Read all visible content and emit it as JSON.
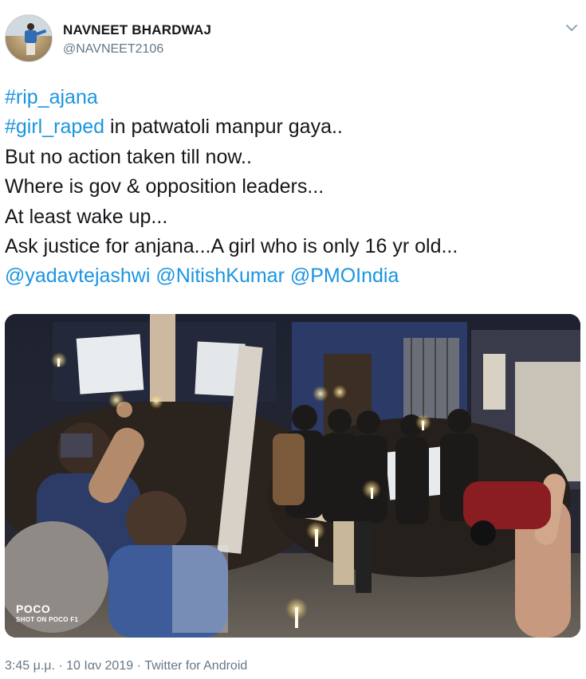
{
  "tweet": {
    "author_name": "NAVNEET BHARDWAJ",
    "author_handle": "@NAVNEET2106",
    "lines": [
      {
        "link": "#rip_ajana",
        "text": ""
      },
      {
        "link": "#girl_raped",
        "text": " in patwatoli manpur gaya.."
      },
      {
        "link": "",
        "text": "But no action taken till now.."
      },
      {
        "link": "",
        "text": "Where is gov & opposition leaders..."
      },
      {
        "link": "",
        "text": "At least wake up..."
      },
      {
        "link": "",
        "text": "Ask justice for anjana...A girl who is only 16 yr old..."
      }
    ],
    "mentions": [
      "@yadavtejashwi",
      "@NitishKumar",
      "@PMOIndia"
    ],
    "photo_watermark": {
      "brand": "POCO",
      "caption": "SHOT ON POCO F1"
    },
    "timestamp": "3:45 μ.μ. · 10 Ιαν 2019 · Twitter for Android"
  },
  "colors": {
    "link": "#1b95e0",
    "text": "#14171a",
    "secondary": "#657786"
  },
  "icons": {
    "chevron": "chevron-down-icon",
    "avatar": "avatar"
  }
}
